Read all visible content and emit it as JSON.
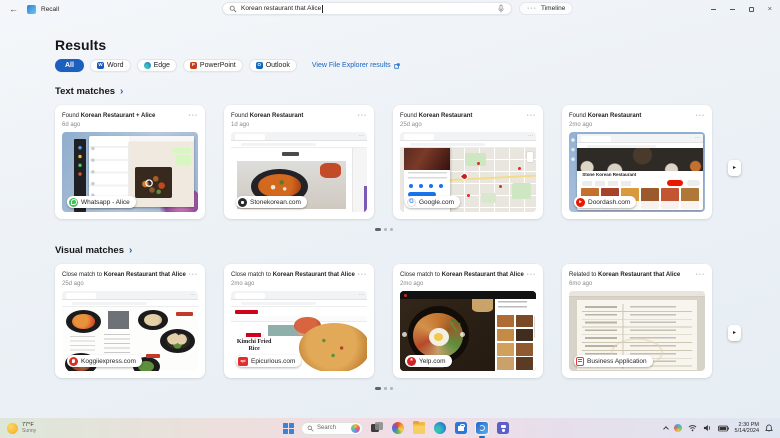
{
  "titlebar": {
    "app_name": "Recall",
    "search_value": "Korean restaurant that Alice",
    "timeline_label": "Timeline"
  },
  "results": {
    "heading": "Results",
    "filters": [
      {
        "label": "All",
        "active": true
      },
      {
        "label": "Word",
        "active": false
      },
      {
        "label": "Edge",
        "active": false
      },
      {
        "label": "PowerPoint",
        "active": false
      },
      {
        "label": "Outlook",
        "active": false
      }
    ],
    "file_explorer_link": "View File Explorer results"
  },
  "colors": {
    "accent_blue": "#1a66c0",
    "all_chip_blue": "#1d5fbf",
    "whatsapp_green": "#3fc351",
    "doordash_red": "#eb1700",
    "yelp_red": "#d32323"
  },
  "sections": [
    {
      "title": "Text matches",
      "cards": [
        {
          "prefix": "Found ",
          "match": "Korean Restaurant + Alice",
          "age": "6d ago",
          "badge": {
            "label": "Whatsapp - Alice",
            "icon": "whatsapp-icon"
          }
        },
        {
          "prefix": "Found ",
          "match": "Korean Restaurant",
          "age": "1d ago",
          "badge": {
            "label": "Stonekorean.com",
            "icon": "globe-dark-icon"
          }
        },
        {
          "prefix": "Found ",
          "match": "Korean Restaurant",
          "age": "25d ago",
          "badge": {
            "label": "Google.com",
            "icon": "google-icon",
            "icon_letter": "G"
          }
        },
        {
          "prefix": "Found ",
          "match": "Korean Restaurant",
          "age": "2mo ago",
          "badge": {
            "label": "Doordash.com",
            "icon": "doordash-icon",
            "icon_letter": "▸"
          },
          "thumb_text": "Stone Korean Restaurant"
        }
      ]
    },
    {
      "title": "Visual matches",
      "cards": [
        {
          "prefix": "Close match to ",
          "match": "Korean Restaurant that Alice",
          "age": "25d ago",
          "badge": {
            "label": "Koggiiexpress.com",
            "icon": "koggii-icon"
          }
        },
        {
          "prefix": "Close match to ",
          "match": "Korean Restaurant that Alice",
          "age": "2mo ago",
          "badge": {
            "label": "Epicurious.com",
            "icon": "epicurious-icon",
            "icon_letter": "epi"
          },
          "thumb_text": "Kimchi Fried Rice"
        },
        {
          "prefix": "Close match to ",
          "match": "Korean Restaurant that Alice",
          "age": "2mo ago",
          "badge": {
            "label": "Yelp.com",
            "icon": "yelp-icon",
            "icon_letter": "*"
          }
        },
        {
          "prefix": "Related to ",
          "match": "Korean Restaurant that Alice",
          "age": "6mo ago",
          "badge": {
            "label": "Business Application",
            "icon": "document-icon"
          }
        }
      ]
    }
  ],
  "taskbar": {
    "weather_temp": "77°F",
    "weather_condition": "Sunny",
    "search_placeholder": "Search",
    "time": "2:30 PM",
    "date": "5/14/2024"
  }
}
